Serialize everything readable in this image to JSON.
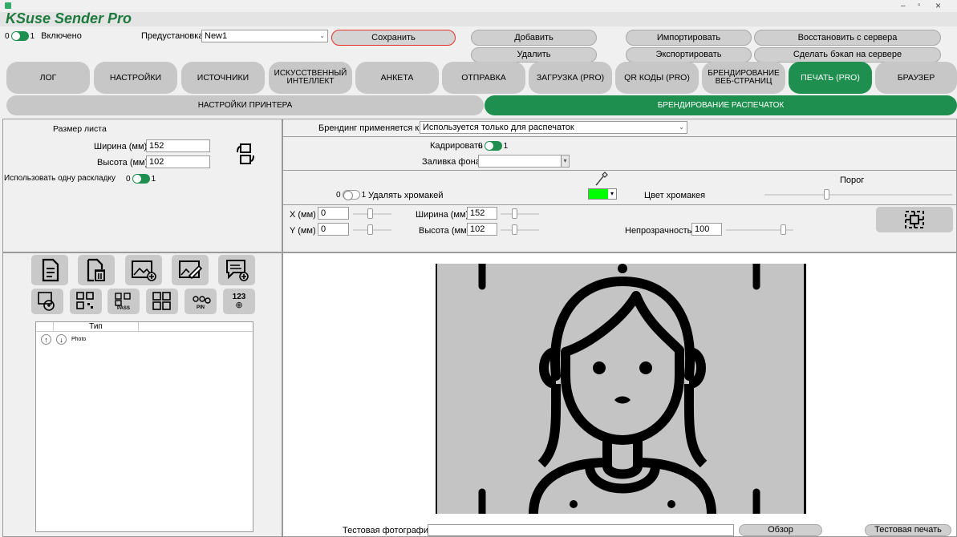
{
  "app": {
    "title": "KSuse Sender Pro"
  },
  "window_controls": {
    "minimize": "–",
    "maximize": "▫",
    "close": "×"
  },
  "topbar": {
    "toggle_off_label": "0",
    "toggle_on_label": "1",
    "enabled_label": "Включено",
    "preset_label": "Предустановка",
    "preset_value": "New1",
    "save": "Сохранить",
    "add": "Добавить",
    "delete": "Удалить",
    "import": "Импортировать",
    "export": "Экспортировать",
    "restore": "Восстановить с сервера",
    "backup": "Сделать бэкап на сервере"
  },
  "tabs": [
    {
      "label": "ЛОГ"
    },
    {
      "label": "НАСТРОЙКИ"
    },
    {
      "label": "ИСТОЧНИКИ"
    },
    {
      "label": "ИСКУССТВЕННЫЙ ИНТЕЛЛЕКТ"
    },
    {
      "label": "АНКЕТА"
    },
    {
      "label": "ОТПРАВКА"
    },
    {
      "label": "ЗАГРУЗКА (PRO)"
    },
    {
      "label": "QR КОДЫ (PRO)"
    },
    {
      "label": "БРЕНДИРОВАНИЕ ВЕБ-СТРАНИЦ"
    },
    {
      "label": "ПЕЧАТЬ (PRO)"
    },
    {
      "label": "БРАУЗЕР"
    }
  ],
  "subtabs": {
    "printer": "НАСТРОЙКИ ПРИНТЕРА",
    "branding": "БРЕНДИРОВАНИЕ РАСПЕЧАТОК"
  },
  "sheet": {
    "title": "Размер листа",
    "width_label": "Ширина (мм)",
    "width_value": "152",
    "height_label": "Высота (мм)",
    "height_value": "102",
    "one_layout_label": "Использовать одну раскладку",
    "off": "0",
    "on": "1"
  },
  "branding": {
    "applies_label": "Брендинг применяется к",
    "applies_value": "Используется только для распечаток",
    "crop_label": "Кадрировать",
    "crop_off": "0",
    "crop_on": "1",
    "bg_fill_label": "Заливка фона",
    "bg_fill_value": "",
    "chroma_off": "0",
    "chroma_on": "1",
    "chroma_label": "Удалять хромакей",
    "chroma_color_label": "Цвет хромакея",
    "chroma_color": "#00ff00",
    "threshold_label": "Порог",
    "x_label": "X (мм)",
    "x_value": "0",
    "y_label": "Y (мм)",
    "y_value": "0",
    "w_label": "Ширина (мм)",
    "w_value": "152",
    "h_label": "Высота (мм)",
    "h_value": "102",
    "opacity_label": "Непрозрачность",
    "opacity_value": "100"
  },
  "layers": {
    "col_type": "Тип",
    "rows": [
      {
        "type": "Photo"
      }
    ],
    "icon_pass": "PASS",
    "icon_pin": "PIN",
    "icon_123": "123"
  },
  "bottom": {
    "test_photo_label": "Тестовая фотография",
    "test_photo_value": "",
    "browse": "Обзор",
    "test_print": "Тестовая печать"
  },
  "colors": {
    "accent": "#1e8f4e",
    "title": "#1d7a3d"
  }
}
